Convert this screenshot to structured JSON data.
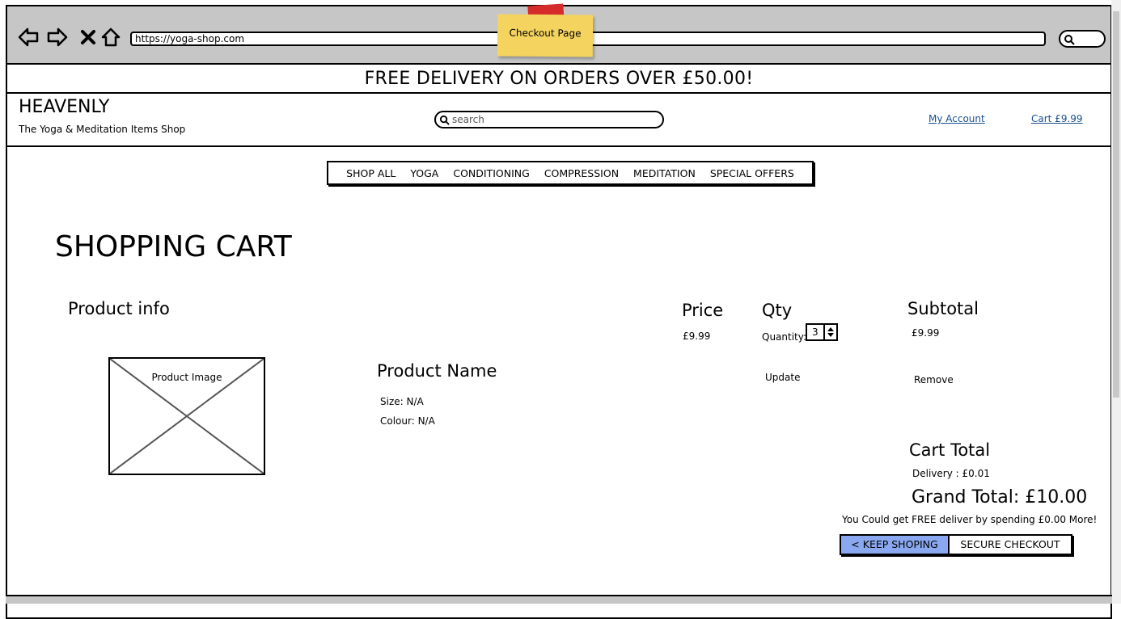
{
  "browser": {
    "url": "https://yoga-shop.com",
    "sticky_note": "Checkout Page"
  },
  "promo": {
    "text": "FREE DELIVERY ON ORDERS OVER £50.00!"
  },
  "header": {
    "logo": "HEAVENLY",
    "tagline": "The Yoga & Meditation Items Shop",
    "search_placeholder": "search",
    "my_account": "My Account",
    "cart": "Cart £9.99"
  },
  "menu": [
    "SHOP ALL",
    "YOGA",
    "CONDITIONING",
    "COMPRESSION",
    "MEDITATION",
    "SPECIAL OFFERS"
  ],
  "cart": {
    "title": "SHOPPING CART",
    "headers": {
      "product_info": "Product info",
      "price": "Price",
      "qty": "Qty",
      "subtotal": "Subtotal"
    },
    "item": {
      "image_label": "Product Image",
      "name": "Product Name",
      "size": "Size: N/A",
      "colour": "Colour: N/A",
      "price": "£9.99",
      "quantity_label": "Quantity:",
      "quantity": "3",
      "subtotal": "£9.99",
      "update": "Update",
      "remove": "Remove"
    },
    "totals": {
      "heading": "Cart Total",
      "delivery": "Delivery : £0.01",
      "grand_total": "Grand Total: £10.00",
      "free_delivery_note": "You Could get FREE deliver by spending £0.00 More!"
    },
    "buttons": {
      "keep_shopping": "< KEEP SHOPING",
      "secure_checkout": "SECURE CHECKOUT"
    }
  }
}
